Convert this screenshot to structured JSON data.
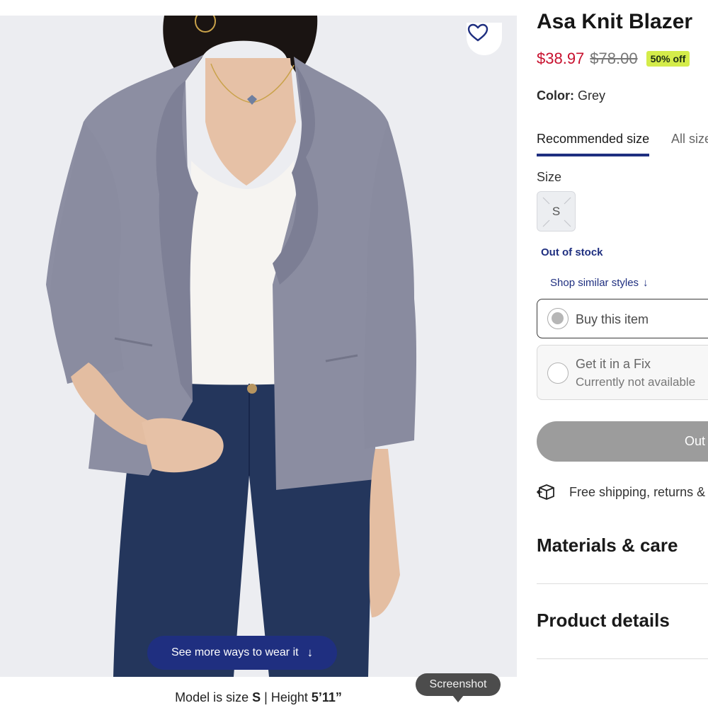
{
  "product": {
    "title": "Asa Knit Blazer",
    "sale_price": "$38.97",
    "original_price": "$78.00",
    "discount_badge": "50% off",
    "color_label": "Color:",
    "color_value": "Grey"
  },
  "size_tabs": {
    "recommended": "Recommended size",
    "all": "All size"
  },
  "size": {
    "label": "Size",
    "option": "S",
    "stock_status": "Out of stock",
    "shop_similar": "Shop similar styles"
  },
  "purchase_options": [
    {
      "title": "Buy this item",
      "selected": true
    },
    {
      "title": "Get it in a Fix",
      "subtitle": "Currently not available"
    }
  ],
  "cta_label": "Out",
  "shipping_text": "Free shipping, returns &",
  "sections": {
    "materials": "Materials & care",
    "details": "Product details"
  },
  "image": {
    "wear_button": "See more ways to wear it",
    "model_prefix": "Model is size",
    "model_size": "S",
    "model_separator": "| Height",
    "model_height": "5’11”"
  },
  "overlay": {
    "screenshot_label": "Screenshot"
  },
  "icons": {
    "favorite": "heart-icon",
    "wear_arrow": "arrow-down-icon",
    "similar_arrow": "arrow-down-icon",
    "shipping": "package-return-icon"
  },
  "colors": {
    "sale_price": "#c8102e",
    "brand_navy": "#1f2f80",
    "discount_badge": "#d4ec4a",
    "cta_disabled": "#9c9c9c"
  }
}
